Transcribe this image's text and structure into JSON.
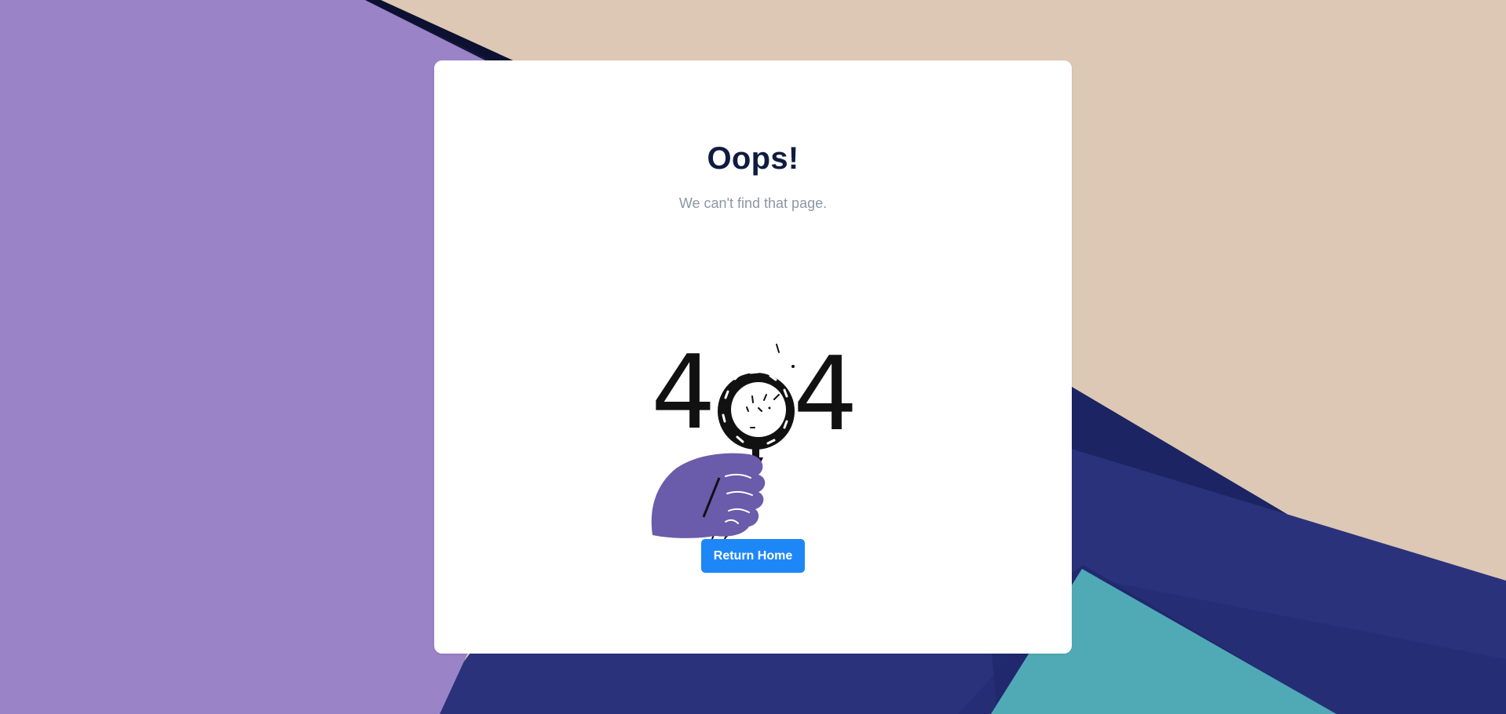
{
  "page": {
    "title": "Oops!",
    "subtitle": "We can't find that page.",
    "illustration_text": [
      "4",
      "4"
    ],
    "button_label": "Return Home"
  },
  "colors": {
    "title": "#0f1c3f",
    "subtitle": "#8d96a6",
    "button": "#1e87f8",
    "hand": "#6a5bab",
    "bg_purple": "#9a83c6",
    "bg_navy": "#28307a",
    "bg_teal": "#4fa9b5",
    "bg_beige": "#e6d2bf"
  },
  "icons": {
    "illustration": "404-magnifying-glass-hand-illustration"
  }
}
